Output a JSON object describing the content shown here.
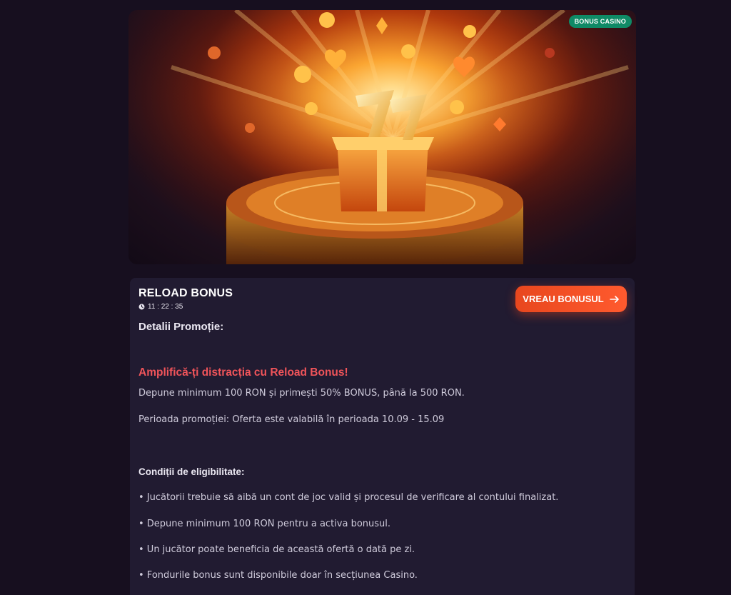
{
  "hero": {
    "badge": "BONUS CASINO",
    "image": "reload-bonus-gift-box-illustration"
  },
  "promo": {
    "title": "RELOAD BONUS",
    "timer": "11 : 22 : 35",
    "cta_label": "VREAU BONUSUL",
    "details_heading": "Detalii Promoție:",
    "headline": "Amplifică-ți distracția cu Reload Bonus!",
    "description": "Depune minimum 100 RON și primești 50% BONUS, până la 500 RON.",
    "period": "Perioada promoției: Oferta este valabilă în perioada 10.09 - 15.09",
    "eligibility_heading": "Condiții de eligibilitate:",
    "conditions": [
      "• Jucătorii trebuie să aibă un cont de joc valid și procesul de verificare al contului finalizat.",
      "• Depune minimum 100 RON pentru a activa bonusul.",
      "• Un jucător poate beneficia de această ofertă o dată pe zi.",
      "• Fondurile bonus sunt disponibile doar în secțiunea Casino."
    ]
  },
  "colors": {
    "background": "#170f1f",
    "card": "#211b31",
    "accent": "#ff5a2e",
    "headline": "#f0545a",
    "badge": "#0f8a66"
  },
  "icons": {
    "timer": "clock-icon",
    "cta": "arrow-right-icon"
  }
}
